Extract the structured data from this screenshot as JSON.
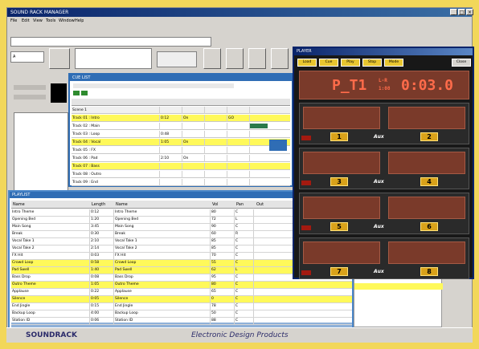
{
  "main_window": {
    "title": "SOUND RACK MANAGER"
  },
  "menu": [
    "File",
    "Edit",
    "View",
    "Tools",
    "Window",
    "Help"
  ],
  "toolbar": {
    "address_label": "Ch",
    "combo_value": "A"
  },
  "grid1": {
    "title": "CUE LIST",
    "rows": [
      {
        "cls": "g",
        "a": "Scene 1",
        "b": "",
        "c": "",
        "d": "",
        "e": ""
      },
      {
        "cls": "y",
        "a": "Track 01 : Intro",
        "b": "0:12",
        "c": "On",
        "d": "",
        "e": "GO"
      },
      {
        "cls": "",
        "a": "Track 02 : Main",
        "b": "",
        "c": "",
        "d": "",
        "e": ""
      },
      {
        "cls": "",
        "a": "Track 03 : Loop",
        "b": "0:48",
        "c": "",
        "d": "",
        "e": ""
      },
      {
        "cls": "y",
        "a": "Track 04 : Vocal",
        "b": "1:05",
        "c": "On",
        "d": "",
        "e": ""
      },
      {
        "cls": "",
        "a": "Track 05 : FX",
        "b": "",
        "c": "",
        "d": "",
        "e": ""
      },
      {
        "cls": "",
        "a": "Track 06 : Pad",
        "b": "2:10",
        "c": "On",
        "d": "",
        "e": ""
      },
      {
        "cls": "y",
        "a": "Track 07 : Bass",
        "b": "",
        "c": "",
        "d": "",
        "e": ""
      },
      {
        "cls": "",
        "a": "Track 08 : Outro",
        "b": "",
        "c": "",
        "d": "",
        "e": ""
      },
      {
        "cls": "",
        "a": "Track 09 : End",
        "b": "",
        "c": "",
        "d": "",
        "e": ""
      }
    ]
  },
  "grid2": {
    "title": "PLAYLIST",
    "headers": [
      "Name",
      "Length",
      "Name",
      "Vol",
      "Pan",
      "Out"
    ],
    "rows": [
      {
        "cls": "",
        "a": "Intro Theme",
        "b": "0:12",
        "c": "Intro Theme",
        "d": "80",
        "e": "C"
      },
      {
        "cls": "",
        "a": "Opening Bed",
        "b": "1:20",
        "c": "Opening Bed",
        "d": "72",
        "e": "L"
      },
      {
        "cls": "",
        "a": "Main Song",
        "b": "3:45",
        "c": "Main Song",
        "d": "90",
        "e": "C"
      },
      {
        "cls": "",
        "a": "Break",
        "b": "0:30",
        "c": "Break",
        "d": "60",
        "e": "R"
      },
      {
        "cls": "",
        "a": "Vocal Take 1",
        "b": "2:10",
        "c": "Vocal Take 1",
        "d": "85",
        "e": "C"
      },
      {
        "cls": "",
        "a": "Vocal Take 2",
        "b": "2:14",
        "c": "Vocal Take 2",
        "d": "85",
        "e": "C"
      },
      {
        "cls": "",
        "a": "FX Hit",
        "b": "0:03",
        "c": "FX Hit",
        "d": "70",
        "e": "C"
      },
      {
        "cls": "y",
        "a": "Crowd Loop",
        "b": "0:58",
        "c": "Crowd Loop",
        "d": "55",
        "e": "C"
      },
      {
        "cls": "y",
        "a": "Pad Swell",
        "b": "1:40",
        "c": "Pad Swell",
        "d": "62",
        "e": "L"
      },
      {
        "cls": "",
        "a": "Bass Drop",
        "b": "0:08",
        "c": "Bass Drop",
        "d": "95",
        "e": "C"
      },
      {
        "cls": "y",
        "a": "Outro Theme",
        "b": "1:05",
        "c": "Outro Theme",
        "d": "80",
        "e": "C"
      },
      {
        "cls": "",
        "a": "Applause",
        "b": "0:22",
        "c": "Applause",
        "d": "65",
        "e": "C"
      },
      {
        "cls": "y",
        "a": "Silence",
        "b": "0:05",
        "c": "Silence",
        "d": "0",
        "e": "C"
      },
      {
        "cls": "",
        "a": "End Jingle",
        "b": "0:15",
        "c": "End Jingle",
        "d": "78",
        "e": "C"
      },
      {
        "cls": "",
        "a": "Backup Loop",
        "b": "4:00",
        "c": "Backup Loop",
        "d": "50",
        "e": "C"
      },
      {
        "cls": "",
        "a": "Station ID",
        "b": "0:06",
        "c": "Station ID",
        "d": "88",
        "e": "C"
      }
    ]
  },
  "ctrl": {
    "title": "PLAYER",
    "tabs": [
      "Load",
      "Cue",
      "Play",
      "Stop",
      "Mode",
      "Close"
    ],
    "display_main": "P_T1",
    "display_sub1": "L-R",
    "display_sub2": "1:08",
    "display_time": "0:03.0",
    "players": [
      "1",
      "2",
      "3",
      "4",
      "5",
      "6",
      "7",
      "8"
    ],
    "player_logo": "Aux"
  },
  "footer": {
    "brand_left": "SOUNDRACK",
    "brand_right": "Electronic Design Products"
  },
  "colors": {
    "desktop": "#f2d75a",
    "grid_blue": "#2f6db5",
    "highlight": "#fff95a",
    "led": "#ff6b4a"
  }
}
